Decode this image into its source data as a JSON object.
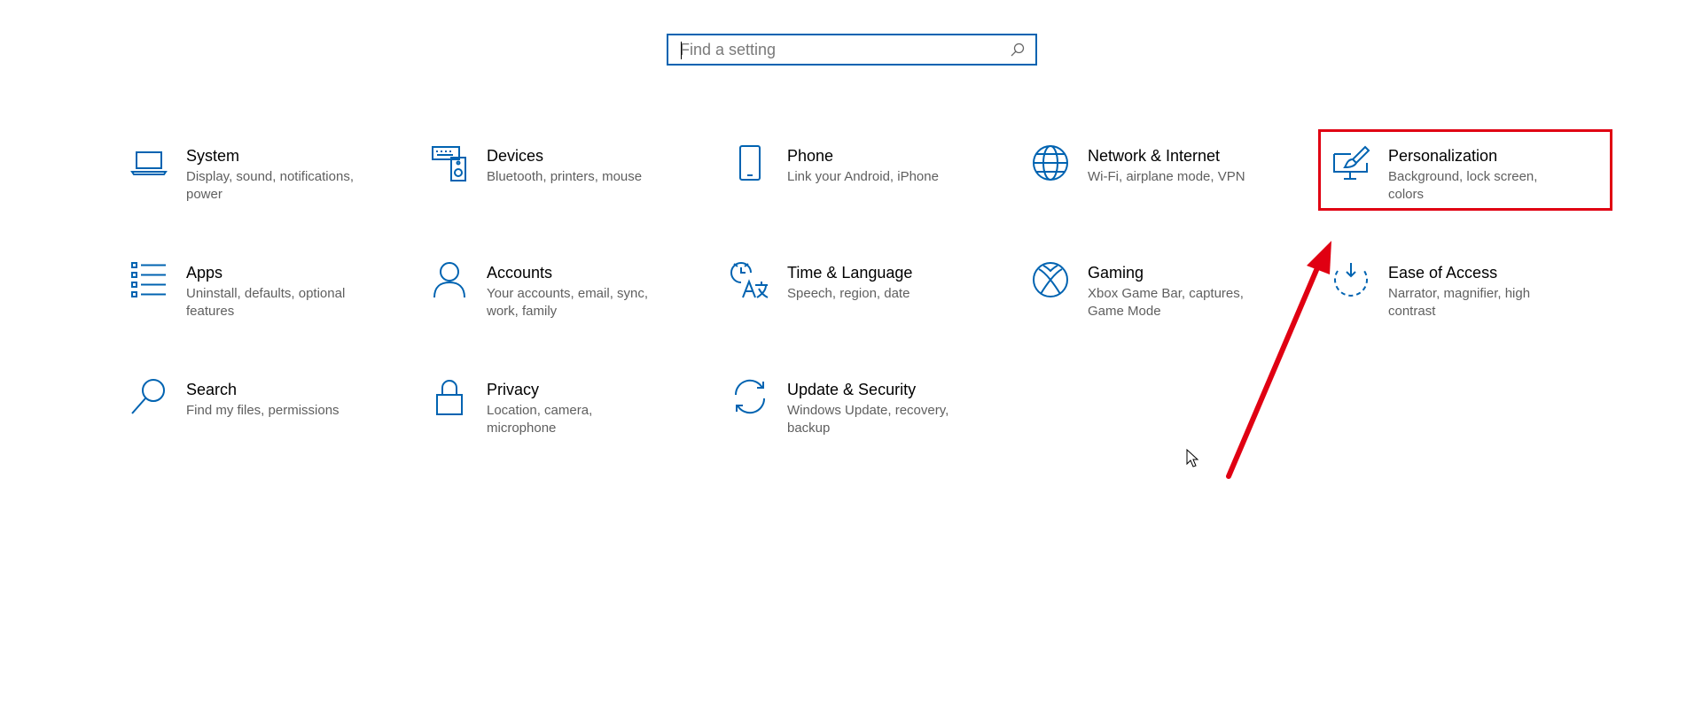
{
  "search": {
    "placeholder": "Find a setting",
    "value": ""
  },
  "tiles": [
    {
      "id": "system",
      "icon": "laptop-icon",
      "title": "System",
      "description": "Display, sound, notifications, power"
    },
    {
      "id": "devices",
      "icon": "devices-icon",
      "title": "Devices",
      "description": "Bluetooth, printers, mouse"
    },
    {
      "id": "phone",
      "icon": "phone-icon",
      "title": "Phone",
      "description": "Link your Android, iPhone"
    },
    {
      "id": "network",
      "icon": "globe-icon",
      "title": "Network & Internet",
      "description": "Wi-Fi, airplane mode, VPN"
    },
    {
      "id": "personalization",
      "icon": "paintbrush-icon",
      "title": "Personalization",
      "description": "Background, lock screen, colors"
    },
    {
      "id": "apps",
      "icon": "apps-list-icon",
      "title": "Apps",
      "description": "Uninstall, defaults, optional features"
    },
    {
      "id": "accounts",
      "icon": "person-icon",
      "title": "Accounts",
      "description": "Your accounts, email, sync, work, family"
    },
    {
      "id": "time-language",
      "icon": "time-language-icon",
      "title": "Time & Language",
      "description": "Speech, region, date"
    },
    {
      "id": "gaming",
      "icon": "xbox-icon",
      "title": "Gaming",
      "description": "Xbox Game Bar, captures, Game Mode"
    },
    {
      "id": "ease-of-access",
      "icon": "ease-of-access-icon",
      "title": "Ease of Access",
      "description": "Narrator, magnifier, high contrast"
    },
    {
      "id": "search",
      "icon": "magnifier-icon",
      "title": "Search",
      "description": "Find my files, permissions"
    },
    {
      "id": "privacy",
      "icon": "lock-icon",
      "title": "Privacy",
      "description": "Location, camera, microphone"
    },
    {
      "id": "update-security",
      "icon": "sync-arrows-icon",
      "title": "Update & Security",
      "description": "Windows Update, recovery, backup"
    }
  ],
  "colors": {
    "accent": "#0063b1",
    "annotation": "#e00012",
    "description_text": "#5f5f5f"
  }
}
